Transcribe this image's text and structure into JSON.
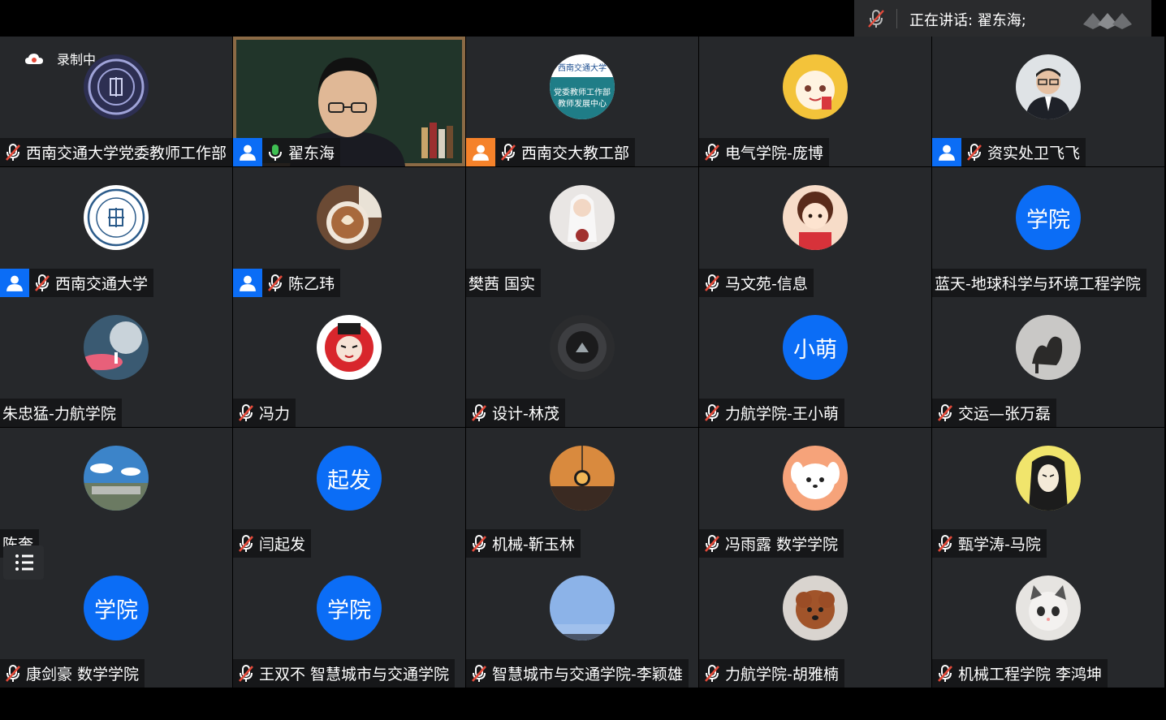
{
  "speaking": {
    "label": "正在讲话: 翟东海;"
  },
  "recording": {
    "label": "录制中"
  },
  "colors": {
    "tile_bg": "#26282b",
    "accent": "#0b6df6",
    "host_orange": "#f5822a",
    "mic_red": "#e54a3a",
    "mic_green": "#3fbf53"
  },
  "tiles": [
    {
      "name": "西南交通大学党委教师工作部",
      "badge": "none",
      "mic": "muted",
      "avatar": "logo-emblem"
    },
    {
      "name": "翟东海",
      "badge": "host",
      "mic": "active",
      "avatar": "video"
    },
    {
      "name": "西南交大教工部",
      "badge": "host-orange",
      "mic": "muted",
      "avatar": "logo-teal"
    },
    {
      "name": "电气学院-庞博",
      "badge": "none",
      "mic": "muted",
      "avatar": "cartoon-tiger"
    },
    {
      "name": "资实处卫飞飞",
      "badge": "host",
      "mic": "muted",
      "avatar": "man-photo"
    },
    {
      "name": "西南交通大学",
      "badge": "host",
      "mic": "muted",
      "avatar": "university-seal"
    },
    {
      "name": "陈乙玮",
      "badge": "host",
      "mic": "muted",
      "avatar": "coffee"
    },
    {
      "name": "樊茜 国实",
      "badge": "none",
      "mic": "none",
      "avatar": "bride"
    },
    {
      "name": "马文苑-信息",
      "badge": "none",
      "mic": "muted",
      "avatar": "cartoon-girl"
    },
    {
      "name": "蓝天-地球科学与环境工程学院",
      "badge": "none",
      "mic": "none",
      "avatar": "text",
      "avatar_text": "学院"
    },
    {
      "name": "朱忠猛-力航学院",
      "badge": "none",
      "mic": "none",
      "avatar": "moon"
    },
    {
      "name": "冯力",
      "badge": "none",
      "mic": "muted",
      "avatar": "opera-mask"
    },
    {
      "name": "设计-林茂",
      "badge": "none",
      "mic": "muted",
      "avatar": "dark-object"
    },
    {
      "name": "力航学院-王小萌",
      "badge": "none",
      "mic": "muted",
      "avatar": "text",
      "avatar_text": "小萌"
    },
    {
      "name": "交运—张万磊",
      "badge": "none",
      "mic": "muted",
      "avatar": "shadow-art"
    },
    {
      "name": "陈奎",
      "badge": "none",
      "mic": "none",
      "avatar": "city-landscape"
    },
    {
      "name": "闫起发",
      "badge": "none",
      "mic": "muted",
      "avatar": "text",
      "avatar_text": "起发"
    },
    {
      "name": "机械-靳玉林",
      "badge": "none",
      "mic": "muted",
      "avatar": "sunset-pendant"
    },
    {
      "name": "冯雨露   数学学院",
      "badge": "none",
      "mic": "muted",
      "avatar": "cartoon-dog"
    },
    {
      "name": "甄学涛-马院",
      "badge": "none",
      "mic": "muted",
      "avatar": "anime-man"
    },
    {
      "name": "康剑豪 数学学院",
      "badge": "none",
      "mic": "muted",
      "avatar": "text",
      "avatar_text": "学院"
    },
    {
      "name": "王双不 智慧城市与交通学院",
      "badge": "none",
      "mic": "muted",
      "avatar": "text",
      "avatar_text": "学院"
    },
    {
      "name": "智慧城市与交通学院-李颖雄",
      "badge": "none",
      "mic": "muted",
      "avatar": "sky"
    },
    {
      "name": "力航学院-胡雅楠",
      "badge": "none",
      "mic": "muted",
      "avatar": "poodle"
    },
    {
      "name": "机械工程学院  李鸿坤",
      "badge": "none",
      "mic": "muted",
      "avatar": "kitten"
    }
  ]
}
